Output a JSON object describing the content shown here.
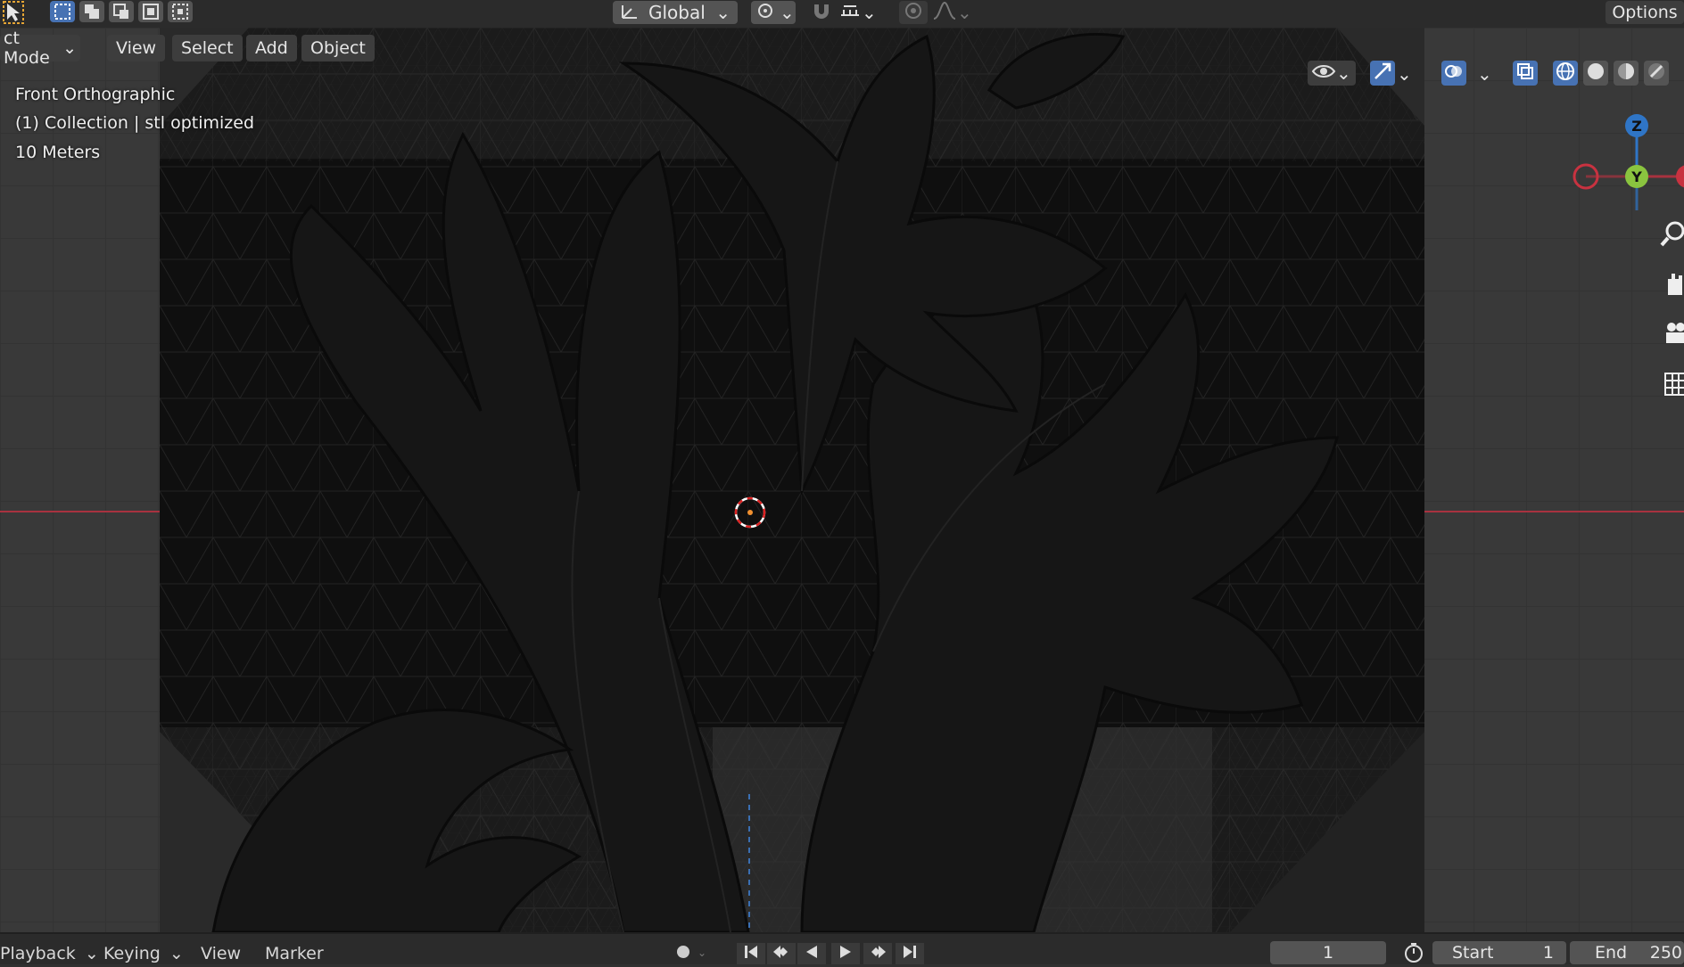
{
  "header": {
    "orientation": "Global",
    "options_label": "Options"
  },
  "viewport_menu": {
    "mode": "ct Mode",
    "items": [
      "View",
      "Select",
      "Add",
      "Object"
    ]
  },
  "overlay": {
    "view_name": "Front Orthographic",
    "collection": "(1) Collection | stl optimized",
    "scale": "10 Meters"
  },
  "gizmo": {
    "z": "Z",
    "y": "Y"
  },
  "timeline": {
    "playback": "Playback",
    "keying": "Keying",
    "view": "View",
    "marker": "Marker",
    "current_frame": "1",
    "start_label": "Start",
    "start_value": "1",
    "end_label": "End",
    "end_value": "250"
  },
  "colors": {
    "x_axis": "#a8323f",
    "y_axis": "#8ac43f",
    "z_axis": "#2f75c6",
    "accent": "#4772b3"
  }
}
